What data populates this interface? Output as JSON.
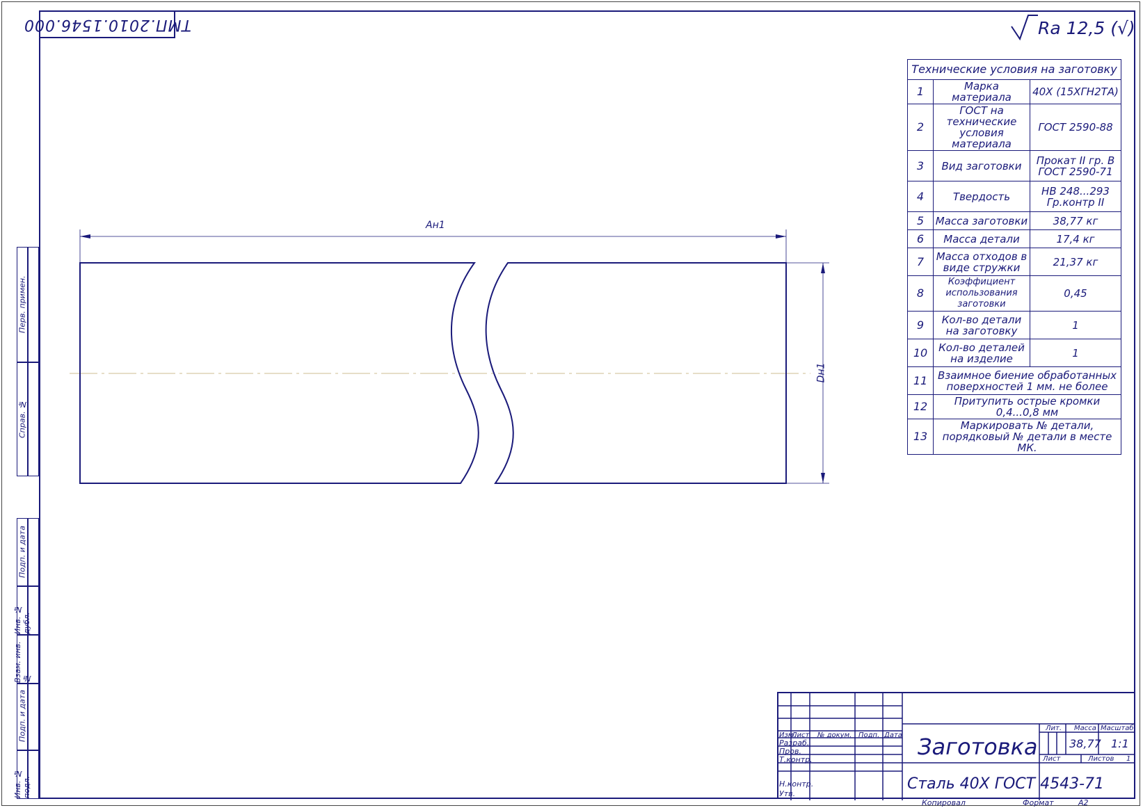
{
  "stamp_doc": "ТМП.2010.1546.000",
  "roughness": "Ra 12,5 (√)",
  "drawing": {
    "dim_length": "Ан1",
    "dim_diameter": "Dн1"
  },
  "tech_table": {
    "title": "Технические условия на заготовку",
    "rows": [
      {
        "n": "1",
        "name": "Марка материала",
        "value": "40Х (15ХГН2ТА)"
      },
      {
        "n": "2",
        "name": "ГОСТ на технические условия материала",
        "value": "ГОСТ 2590-88"
      },
      {
        "n": "3",
        "name": "Вид заготовки",
        "value": "Прокат II гр. В ГОСТ 2590-71"
      },
      {
        "n": "4",
        "name": "Твердость",
        "value": "НВ 248...293 Гр.контр II"
      },
      {
        "n": "5",
        "name": "Масса заготовки",
        "value": "38,77 кг"
      },
      {
        "n": "6",
        "name": "Масса детали",
        "value": "17,4 кг"
      },
      {
        "n": "7",
        "name": "Масса отходов в виде стружки",
        "value": "21,37 кг"
      },
      {
        "n": "8",
        "name": "Коэффициент использования заготовки",
        "value": "0,45"
      },
      {
        "n": "9",
        "name": "Кол-во детали на заготовку",
        "value": "1"
      },
      {
        "n": "10",
        "name": "Кол-во деталей на изделие",
        "value": "1"
      },
      {
        "n": "11",
        "span": "Взаимное биение обработанных поверхностей 1 мм. не более"
      },
      {
        "n": "12",
        "span": "Притупить острые кромки 0,4...0,8 мм"
      },
      {
        "n": "13",
        "span": "Маркировать № детали, порядковый № детали в месте МК."
      }
    ]
  },
  "side_strip": {
    "upper": [
      "Перв. примен.",
      "Справ. №"
    ],
    "lower": [
      "Подп. и дата",
      "Инв. № дубл.",
      "Взам. инв. №",
      "Подп. и дата",
      "Инв. № подл."
    ]
  },
  "title_block": {
    "title": "Заготовка",
    "material": "Сталь 40Х ГОСТ 4543-71",
    "head_cols": [
      "Изм.",
      "Лист",
      "№ докум.",
      "Подп.",
      "Дата"
    ],
    "rows": [
      "Разраб.",
      "Пров.",
      "Т.контр.",
      "",
      "Н.контр.",
      "Утв."
    ],
    "lit_label": "Лит.",
    "mass_label": "Масса",
    "scale_label": "Масштаб",
    "mass": "38,77",
    "scale": "1:1",
    "sheet_label": "Лист",
    "sheets_label": "Листов",
    "sheets": "1",
    "copied": "Копировал",
    "format_label": "Формат",
    "format": "А2"
  }
}
